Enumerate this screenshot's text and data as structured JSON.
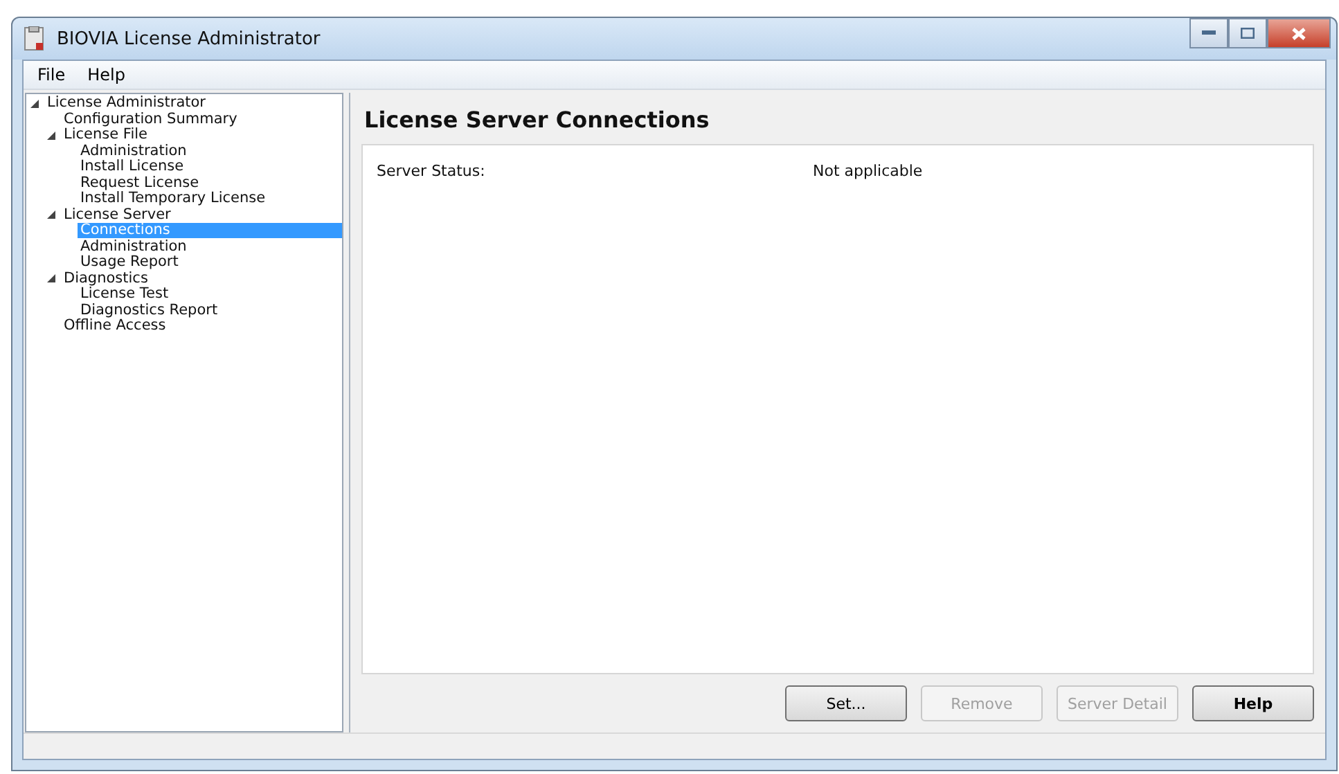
{
  "window": {
    "title": "BIOVIA License Administrator"
  },
  "menu": [
    "File",
    "Help"
  ],
  "tree": [
    {
      "label": "License Administrator",
      "expanded": true,
      "selected": false,
      "children": [
        {
          "label": "Configuration Summary",
          "selected": false
        },
        {
          "label": "License File",
          "expanded": true,
          "selected": false,
          "children": [
            {
              "label": "Administration",
              "selected": false
            },
            {
              "label": "Install License",
              "selected": false
            },
            {
              "label": "Request License",
              "selected": false
            },
            {
              "label": "Install Temporary License",
              "selected": false
            }
          ]
        },
        {
          "label": "License Server",
          "expanded": true,
          "selected": false,
          "children": [
            {
              "label": "Connections",
              "selected": true
            },
            {
              "label": "Administration",
              "selected": false
            },
            {
              "label": "Usage Report",
              "selected": false
            }
          ]
        },
        {
          "label": "Diagnostics",
          "expanded": true,
          "selected": false,
          "children": [
            {
              "label": "License Test",
              "selected": false
            },
            {
              "label": "Diagnostics Report",
              "selected": false
            }
          ]
        },
        {
          "label": "Offline Access",
          "selected": false
        }
      ]
    }
  ],
  "panel": {
    "heading": "License Server Connections",
    "fields": [
      {
        "label": "Server Status:",
        "value": "Not applicable"
      }
    ]
  },
  "buttons": [
    {
      "label": "Set...",
      "disabled": false
    },
    {
      "label": "Remove",
      "disabled": true
    },
    {
      "label": "Server Detail",
      "disabled": true
    },
    {
      "label": "Help",
      "disabled": false
    }
  ]
}
